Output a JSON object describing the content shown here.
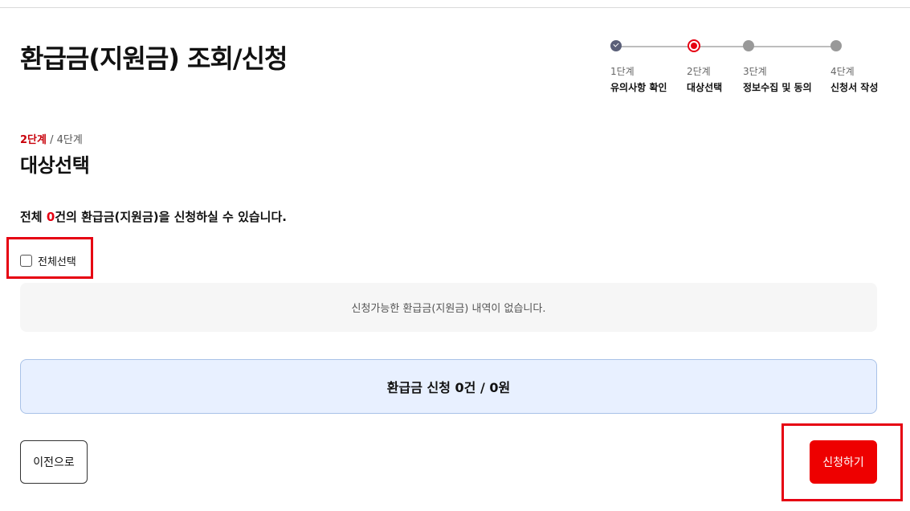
{
  "page": {
    "title": "환급금(지원금) 조회/신청"
  },
  "stepper": {
    "steps": [
      {
        "num": "1단계",
        "name": "유의사항 확인",
        "state": "done"
      },
      {
        "num": "2단계",
        "name": "대상선택",
        "state": "current"
      },
      {
        "num": "3단계",
        "name": "정보수집 및 동의",
        "state": "todo"
      },
      {
        "num": "4단계",
        "name": "신청서 작성",
        "state": "todo"
      }
    ]
  },
  "section": {
    "current_step": "2단계",
    "total_steps": "/ 4단계",
    "title": "대상선택",
    "count_prefix": "전체 ",
    "count": "0",
    "count_suffix": "건의 환급금(지원금)을 신청하실 수 있습니다.",
    "select_all_label": "전체선택",
    "empty_message": "신청가능한 환급금(지원금) 내역이 없습니다.",
    "summary": "환급금 신청 0건 / 0원"
  },
  "buttons": {
    "prev": "이전으로",
    "apply": "신청하기"
  },
  "colors": {
    "accent": "#e60012",
    "summary_bg": "#e8f0ff",
    "done_dot": "#5a5f78"
  }
}
